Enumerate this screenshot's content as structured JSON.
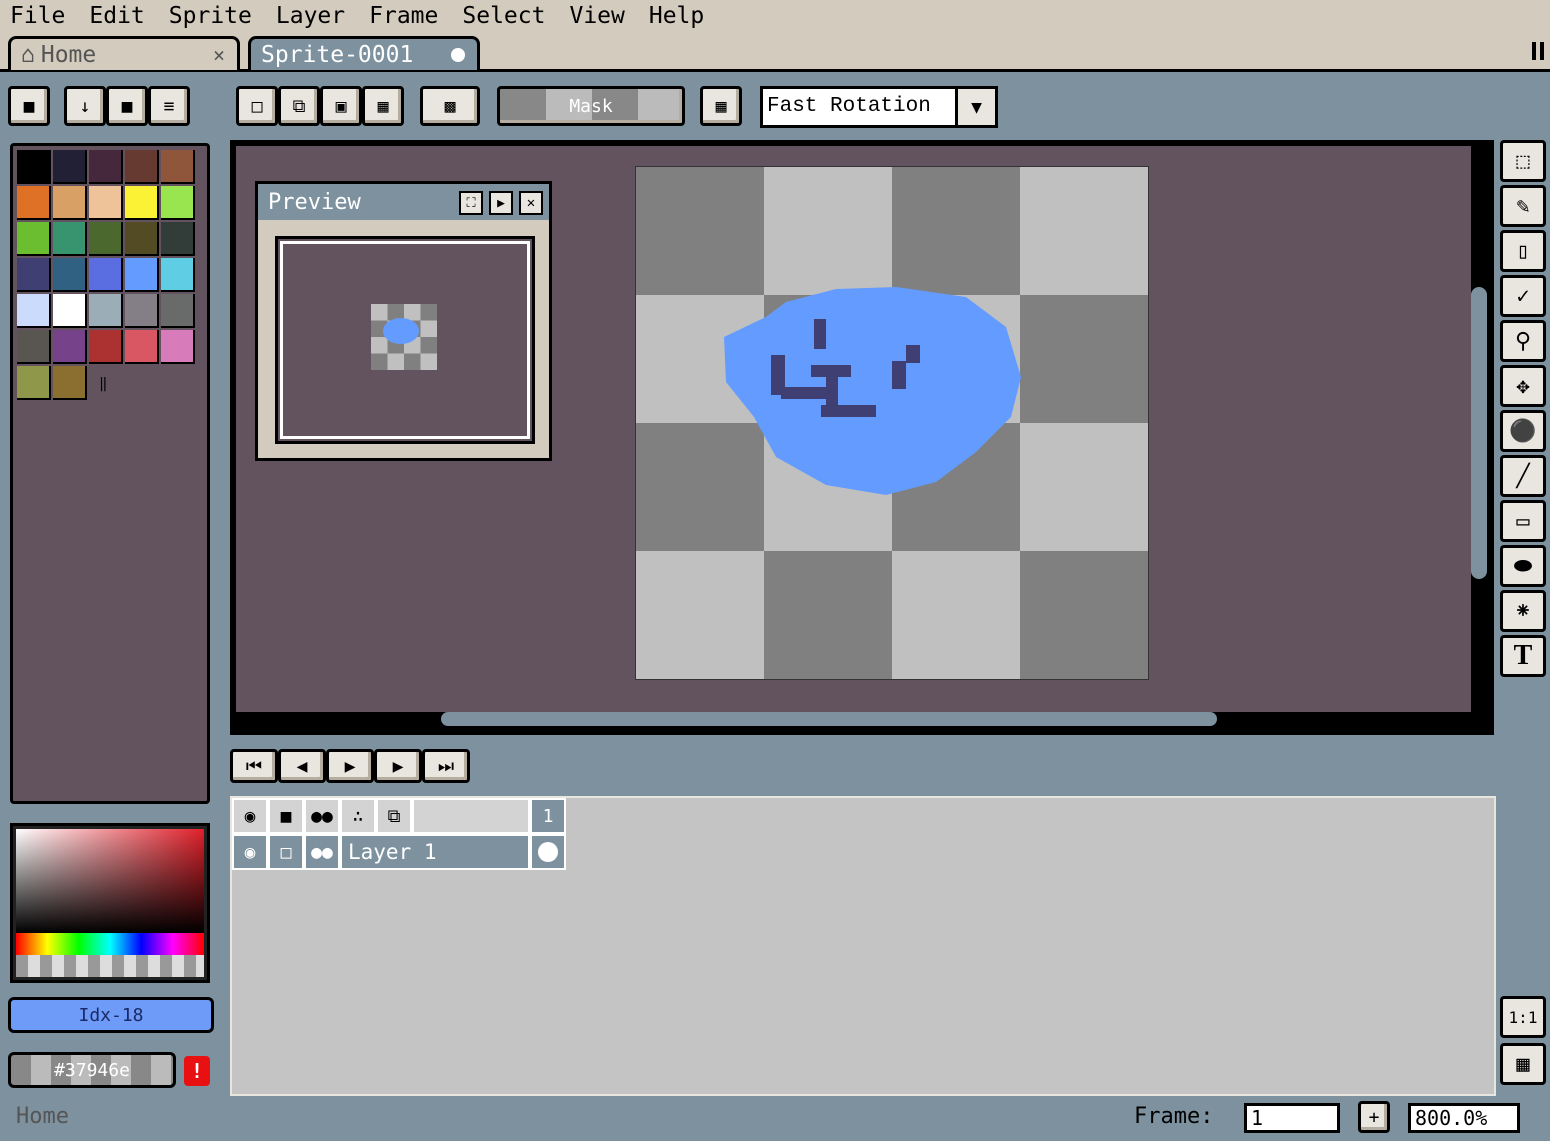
{
  "menu": [
    "File",
    "Edit",
    "Sprite",
    "Layer",
    "Frame",
    "Select",
    "View",
    "Help"
  ],
  "tabs": {
    "home": "Home",
    "sprite": "Sprite-0001",
    "close_glyph": "×"
  },
  "toolbar": {
    "mask_label": "Mask",
    "rotation_algorithm": "Fast Rotation"
  },
  "palette": {
    "colors": [
      "#000000",
      "#222034",
      "#45283c",
      "#663931",
      "#8f563b",
      "#df7126",
      "#d9a066",
      "#eec39a",
      "#fbf236",
      "#99e550",
      "#6abe30",
      "#37946e",
      "#4b692f",
      "#524b24",
      "#323c39",
      "#3f3f74",
      "#306082",
      "#5b6ee1",
      "#639bff",
      "#5fcde4",
      "#cbdbfc",
      "#ffffff",
      "#9badb7",
      "#847e87",
      "#696a6a",
      "#595652",
      "#76428a",
      "#ac3232",
      "#d95763",
      "#d77bba",
      "#8f974a",
      "#8a6f30"
    ]
  },
  "color_bar": {
    "index_label": "Idx-18",
    "hex_label": "#37946e",
    "warning_glyph": "!"
  },
  "preview": {
    "title": "Preview"
  },
  "timeline": {
    "frame_number": "1",
    "layers": [
      {
        "name": "Layer 1"
      }
    ]
  },
  "status": {
    "left_text": "Home",
    "frame_label": "Frame:",
    "frame_value": "1",
    "add_glyph": "+",
    "zoom_value": "800.0%"
  },
  "right_bottom": {
    "one_to_one": "1:1"
  },
  "colors": {
    "ui_bg": "#7d929e",
    "panel_beige": "#d3cbbe",
    "canvas_bg": "#63535e",
    "blob_blue": "#639bff",
    "blob_stroke": "#3f3f74",
    "checker_dark": "#808080",
    "checker_light": "#c0c0c0"
  }
}
